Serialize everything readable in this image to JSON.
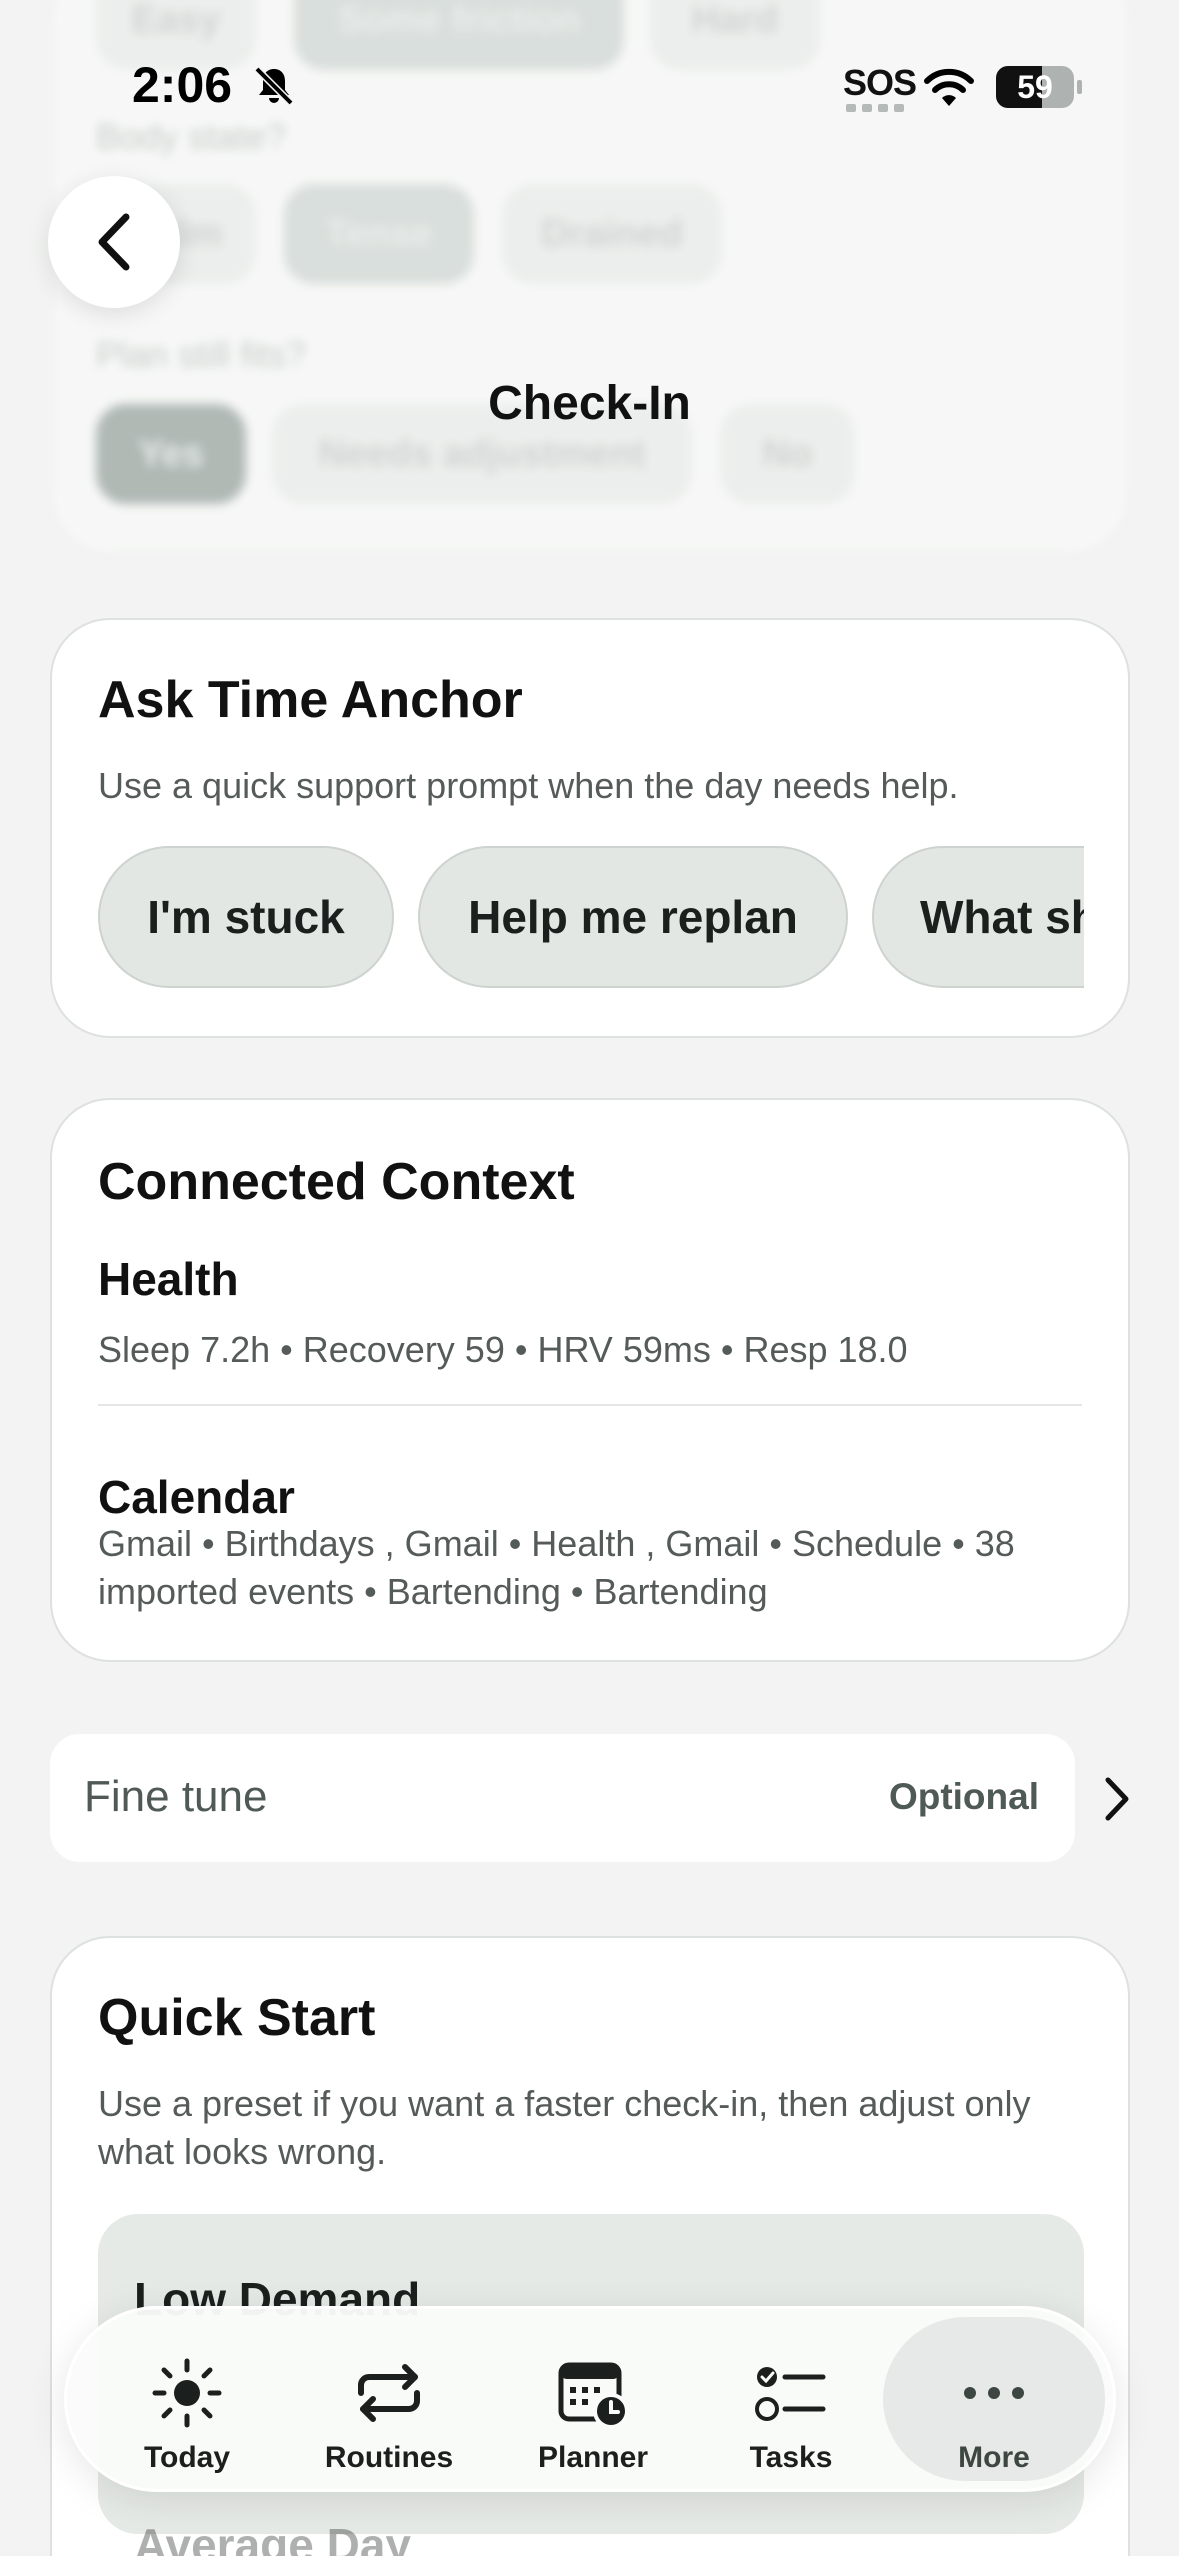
{
  "status_bar": {
    "time": "2:06",
    "sos": "SOS",
    "battery": "59"
  },
  "header": {
    "title": "Check-In"
  },
  "background_checkin": {
    "difficulty_options": [
      "Easy",
      "Some friction",
      "Hard"
    ],
    "body_state_label": "Body state?",
    "body_state_options": [
      "Calm",
      "Tense",
      "Drained"
    ],
    "plan_label": "Plan still fits?",
    "plan_options": [
      "Yes",
      "Needs adjustment",
      "No"
    ]
  },
  "ask": {
    "title": "Ask Time Anchor",
    "subtitle": "Use a quick support prompt when the day needs help.",
    "chips": [
      "I'm stuck",
      "Help me replan",
      "What should I do next?"
    ]
  },
  "context": {
    "title": "Connected Context",
    "health_heading": "Health",
    "health_text": "Sleep 7.2h • Recovery 59 • HRV 59ms • Resp 18.0",
    "calendar_heading": "Calendar",
    "calendar_text": "Gmail • Birthdays , Gmail • Health , Gmail • Schedule • 38 imported events • Bartending • Bartending"
  },
  "fine_tune": {
    "label": "Fine tune",
    "optional": "Optional"
  },
  "quick_start": {
    "title": "Quick Start",
    "subtitle": "Use a preset if you want a faster check-in, then adjust only what looks wrong.",
    "presets": [
      "Low Demand",
      "Average Day"
    ]
  },
  "tabs": [
    {
      "label": "Today",
      "icon": "sun-icon"
    },
    {
      "label": "Routines",
      "icon": "repeat-icon"
    },
    {
      "label": "Planner",
      "icon": "calendar-clock-icon"
    },
    {
      "label": "Tasks",
      "icon": "checklist-icon"
    },
    {
      "label": "More",
      "icon": "ellipsis-icon",
      "active": true
    }
  ]
}
